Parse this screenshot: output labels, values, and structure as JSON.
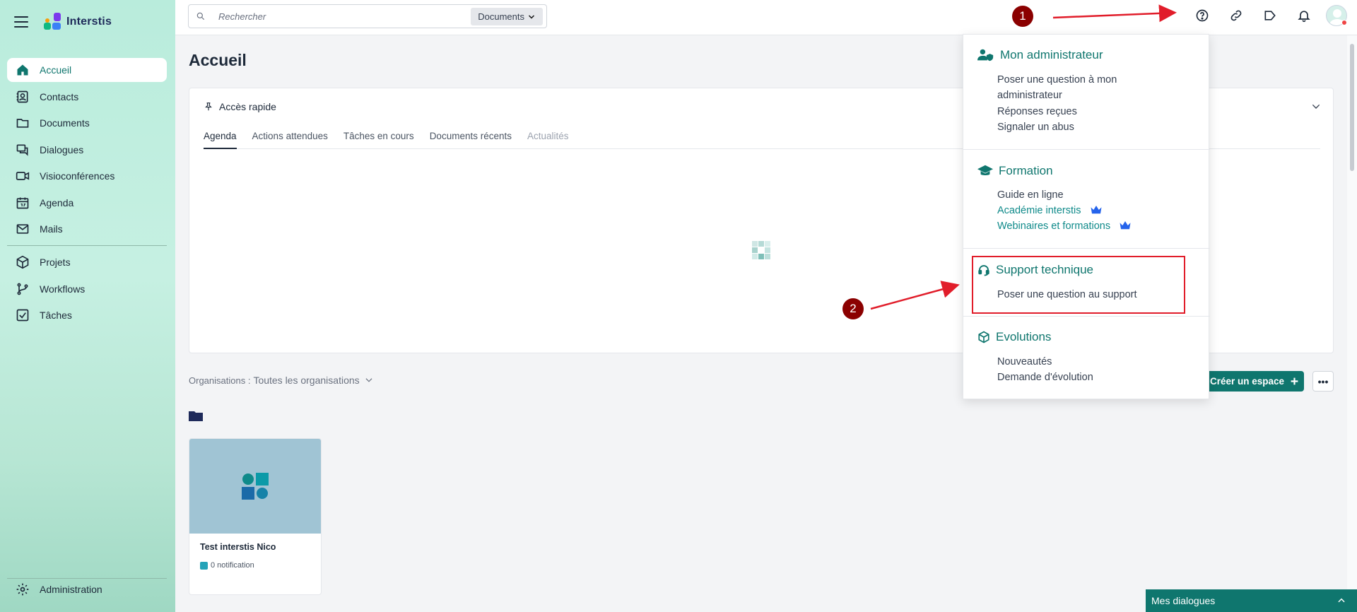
{
  "app": {
    "name": "Interstis"
  },
  "sidebar": {
    "items": [
      {
        "label": "Accueil",
        "icon": "home-icon",
        "active": true
      },
      {
        "label": "Contacts",
        "icon": "contacts-icon"
      },
      {
        "label": "Documents",
        "icon": "folder-icon"
      },
      {
        "label": "Dialogues",
        "icon": "chat-icon"
      },
      {
        "label": "Visioconférences",
        "icon": "video-icon"
      },
      {
        "label": "Agenda",
        "icon": "calendar-icon"
      },
      {
        "label": "Mails",
        "icon": "mail-icon"
      },
      {
        "label": "Projets",
        "icon": "cube-icon"
      },
      {
        "label": "Workflows",
        "icon": "branch-icon"
      },
      {
        "label": "Tâches",
        "icon": "checkbox-icon"
      }
    ],
    "bottom": {
      "label": "Administration",
      "icon": "gear-icon"
    }
  },
  "search": {
    "placeholder": "Rechercher",
    "scope": "Documents"
  },
  "topbar": {
    "icons": [
      "help-icon",
      "link-icon",
      "megaphone-icon",
      "bell-icon",
      "avatar"
    ]
  },
  "page": {
    "title": "Accueil"
  },
  "quick_access": {
    "title": "Accès rapide",
    "tabs": [
      {
        "label": "Agenda",
        "state": "active"
      },
      {
        "label": "Actions attendues",
        "state": "normal"
      },
      {
        "label": "Tâches en cours",
        "state": "normal"
      },
      {
        "label": "Documents récents",
        "state": "normal"
      },
      {
        "label": "Actualités",
        "state": "disabled"
      }
    ]
  },
  "organisations": {
    "label": "Organisations :",
    "value": "Toutes les organisations"
  },
  "spaces": [
    {
      "title": "Test interstis Nico",
      "notifications": "0 notification"
    }
  ],
  "actions": {
    "create_space": "Créer un espace",
    "more": "•••"
  },
  "dialogues_bar": {
    "label": "Mes dialogues"
  },
  "help_menu": {
    "sections": [
      {
        "title": "Mon administrateur",
        "icon": "user-shield-icon",
        "links": [
          "Poser une question à mon administrateur",
          "Réponses reçues",
          "Signaler un abus"
        ]
      },
      {
        "title": "Formation",
        "icon": "graduation-cap-icon",
        "links": [
          "Guide en ligne",
          "Académie interstis",
          "Webinaires et formations"
        ]
      },
      {
        "title": "Support technique",
        "icon": "headset-icon",
        "links": [
          "Poser une question au support"
        ]
      },
      {
        "title": "Evolutions",
        "icon": "box-icon",
        "links": [
          "Nouveautés",
          "Demande d'évolution"
        ]
      }
    ]
  },
  "annotations": {
    "step1": "1",
    "step2": "2"
  },
  "colors": {
    "accent": "#0f766e",
    "annotation_red": "#e11d2a",
    "badge": "#8b0000"
  }
}
